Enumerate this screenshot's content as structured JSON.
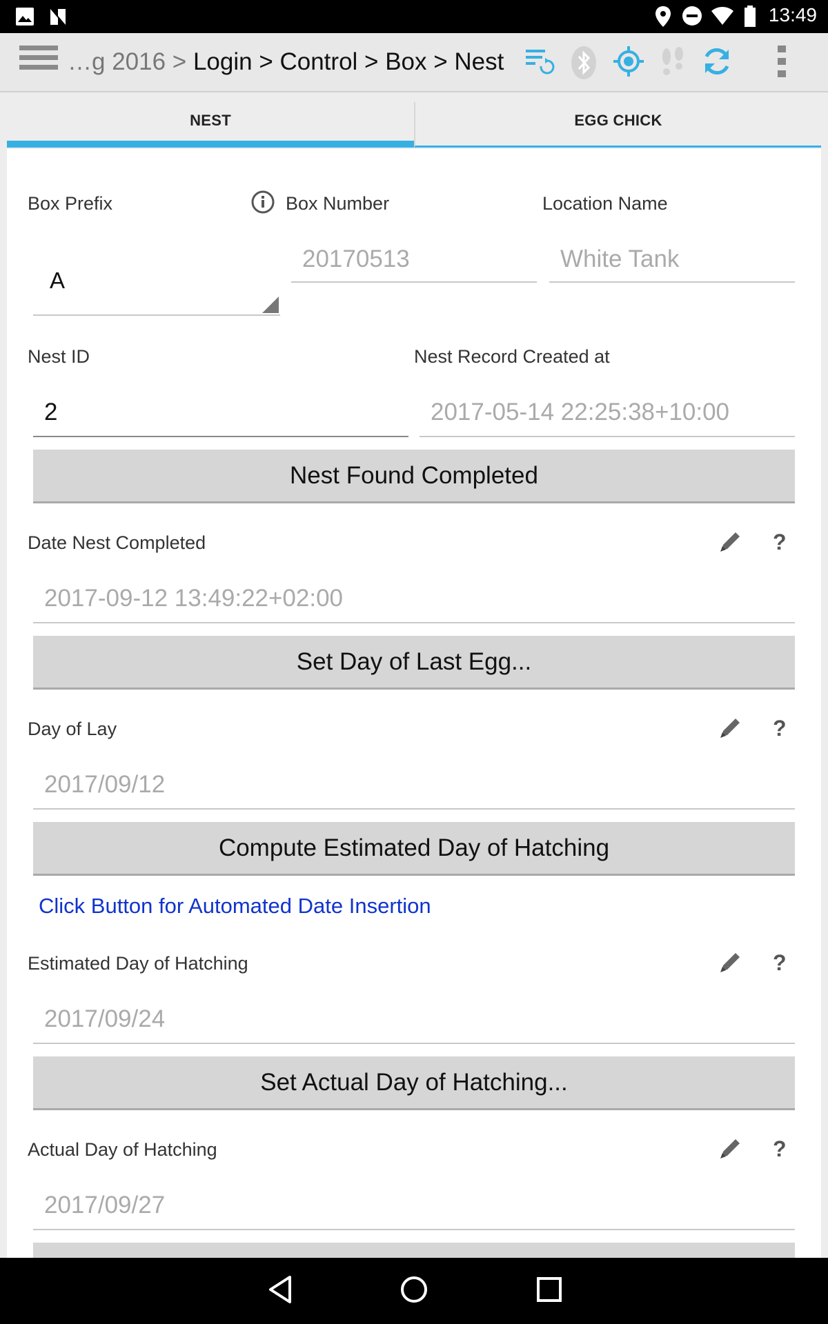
{
  "status_bar": {
    "time": "13:49"
  },
  "action_bar": {
    "breadcrumb_faded": "…g 2016 >",
    "breadcrumb_main": "Login > Control > Box > Nest",
    "icons": [
      "menu-icon",
      "sync-settings-icon",
      "bluetooth-icon",
      "gps-icon",
      "footsteps-icon",
      "refresh-icon",
      "overflow-icon"
    ]
  },
  "tabs": {
    "nest": "NEST",
    "egg_chick": "EGG CHICK"
  },
  "form": {
    "box_prefix_label": "Box Prefix",
    "box_number_label": "Box Number",
    "location_name_label": "Location Name",
    "box_prefix_value": "A",
    "box_number_value": "20170513",
    "location_name_value": "White Tank",
    "nest_id_label": "Nest ID",
    "nest_created_label": "Nest Record Created at",
    "nest_id_value": "2",
    "nest_created_value": "2017-05-14 22:25:38+10:00",
    "btn_nest_found": "Nest Found Completed",
    "date_nest_completed_label": "Date Nest Completed",
    "date_nest_completed_value": "2017-09-12 13:49:22+02:00",
    "btn_set_last_egg": "Set Day of Last Egg...",
    "day_of_lay_label": "Day of Lay",
    "day_of_lay_value": "2017/09/12",
    "btn_compute_hatch": "Compute Estimated Day of Hatching",
    "automated_hint": "Click Button for Automated Date Insertion",
    "est_hatch_label": "Estimated Day of Hatching",
    "est_hatch_value": "2017/09/24",
    "btn_set_actual_hatch": "Set Actual Day of Hatching...",
    "actual_hatch_label": "Actual Day of Hatching",
    "actual_hatch_value": "2017/09/27",
    "help_symbol": "?"
  },
  "colors": {
    "accent": "#36b0e2",
    "link": "#1133cc",
    "button_bg": "#d6d6d6"
  }
}
